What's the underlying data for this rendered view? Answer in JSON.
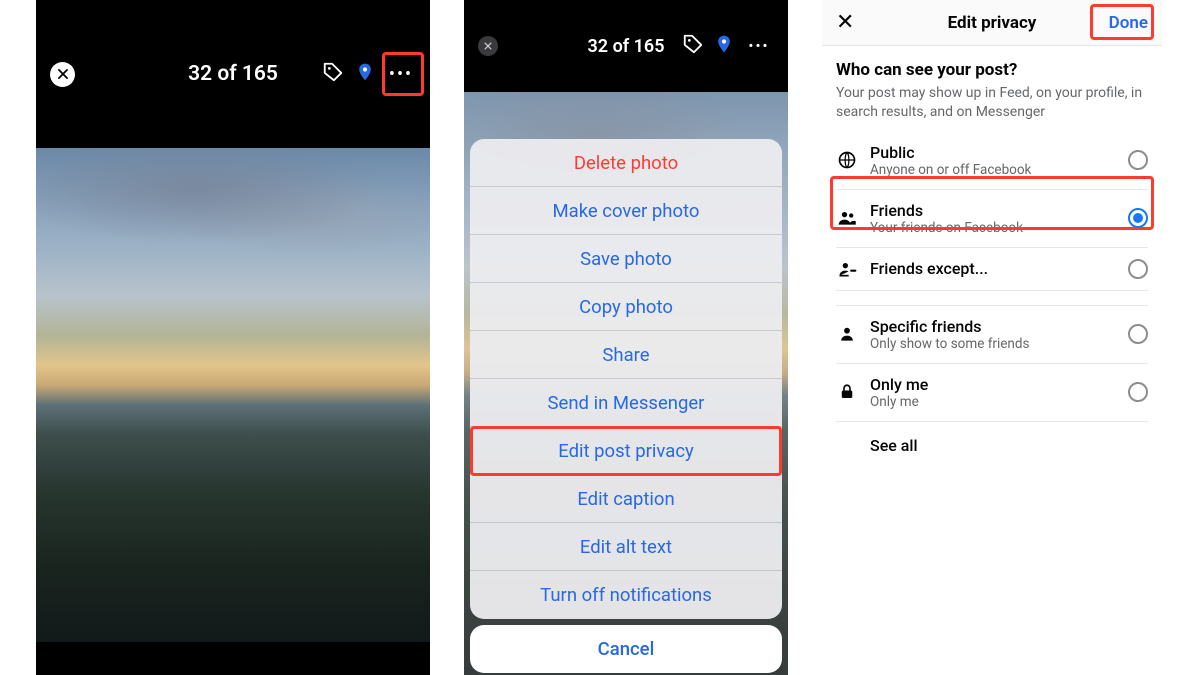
{
  "panel1": {
    "counter": "32 of 165"
  },
  "panel2": {
    "counter": "32 of 165",
    "sheet": {
      "delete": "Delete photo",
      "make_cover": "Make cover photo",
      "save": "Save photo",
      "copy": "Copy photo",
      "share": "Share",
      "messenger": "Send in Messenger",
      "edit_privacy": "Edit post privacy",
      "edit_caption": "Edit caption",
      "edit_alt": "Edit alt text",
      "turn_off": "Turn off notifications",
      "cancel": "Cancel"
    }
  },
  "panel3": {
    "title": "Edit privacy",
    "done": "Done",
    "who_title": "Who can see your post?",
    "who_sub": "Your post may show up in Feed, on your profile, in search results, and on Messenger",
    "options": {
      "public": {
        "label": "Public",
        "sub": "Anyone on or off Facebook",
        "selected": false
      },
      "friends": {
        "label": "Friends",
        "sub": "Your friends on Facebook",
        "selected": true
      },
      "friends_except": {
        "label": "Friends except...",
        "sub": "",
        "selected": false
      },
      "specific": {
        "label": "Specific friends",
        "sub": "Only show to some friends",
        "selected": false
      },
      "only_me": {
        "label": "Only me",
        "sub": "Only me",
        "selected": false
      }
    },
    "see_all": "See all"
  }
}
